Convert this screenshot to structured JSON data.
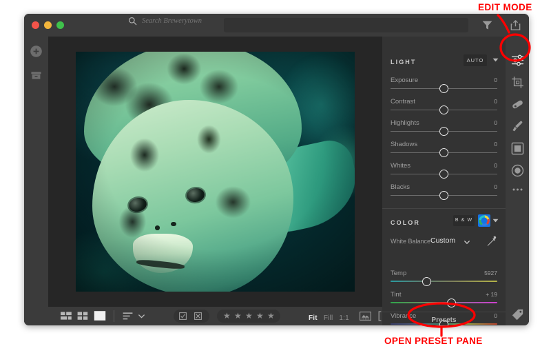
{
  "window": {
    "traffic_lights": [
      "close",
      "minimize",
      "maximize"
    ]
  },
  "titlebar": {
    "search_placeholder": "Search Brewerytown",
    "search_value": "",
    "icons": [
      "search-icon",
      "filter-icon",
      "share-icon",
      "cloud-icon"
    ]
  },
  "left_rail": {
    "items": [
      {
        "name": "add-photos",
        "icon": "plus-circle-icon"
      },
      {
        "name": "albums",
        "icon": "archive-box-icon"
      }
    ]
  },
  "right_rail": {
    "items": [
      {
        "name": "edit",
        "icon": "sliders-icon",
        "active": true
      },
      {
        "name": "crop",
        "icon": "crop-icon",
        "active": false
      },
      {
        "name": "healing",
        "icon": "healing-brush-icon",
        "active": false
      },
      {
        "name": "brush",
        "icon": "brush-icon",
        "active": false
      },
      {
        "name": "linear-gradient",
        "icon": "linear-gradient-icon",
        "active": false
      },
      {
        "name": "radial-gradient",
        "icon": "radial-gradient-icon",
        "active": false
      },
      {
        "name": "more-options",
        "icon": "ellipsis-icon",
        "active": false
      },
      {
        "name": "tags",
        "icon": "tag-icon",
        "active": false
      },
      {
        "name": "info",
        "icon": "info-circle-icon",
        "active": false
      }
    ]
  },
  "bottom_bar": {
    "view_compact": "compact-grid-icon",
    "view_grid": "grid-icon",
    "view_single": "single-photo-icon",
    "sort": "sort-icon",
    "sort_chevron": "chevron-down-icon",
    "flag_pick": "flag-pick-icon",
    "flag_reject": "flag-reject-icon",
    "stars": [
      "star",
      "star",
      "star",
      "star",
      "star"
    ],
    "star_rating": 0,
    "zoom_options": [
      {
        "label": "Fit",
        "active": true
      },
      {
        "label": "Fill",
        "active": false
      },
      {
        "label": "1:1",
        "active": false
      }
    ],
    "compare_icon": "compare-view-icon",
    "before_after_icon": "before-after-icon"
  },
  "edit_panel": {
    "light": {
      "title": "LIGHT",
      "auto_label": "AUTO",
      "sliders": [
        {
          "label": "Exposure",
          "value": "0",
          "pos": 50
        },
        {
          "label": "Contrast",
          "value": "0",
          "pos": 50
        },
        {
          "label": "Highlights",
          "value": "0",
          "pos": 50
        },
        {
          "label": "Shadows",
          "value": "0",
          "pos": 50
        },
        {
          "label": "Whites",
          "value": "0",
          "pos": 50
        },
        {
          "label": "Blacks",
          "value": "0",
          "pos": 50
        }
      ]
    },
    "color": {
      "title": "COLOR",
      "bw_label": "B & W",
      "color_wheel_active": true,
      "accent": "#1473e6",
      "white_balance": {
        "label": "White Balance",
        "value": "Custom",
        "eyedropper": "eyedropper-icon"
      },
      "sliders": [
        {
          "label": "Temp",
          "value": "5927",
          "pos": 34
        },
        {
          "label": "Tint",
          "value": "+ 19",
          "pos": 57
        },
        {
          "label": "Vibrance",
          "value": "0",
          "pos": 50
        }
      ]
    },
    "presets_label": "Presets"
  },
  "annotations": [
    {
      "name": "edit-mode",
      "text": "EDIT MODE",
      "color": "#ff0000"
    },
    {
      "name": "open-preset-pane",
      "text": "OPEN PRESET PANE",
      "color": "#ff0000"
    }
  ]
}
